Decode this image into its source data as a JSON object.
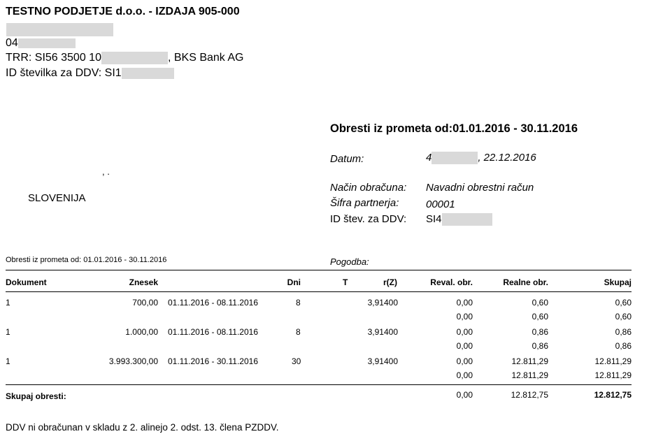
{
  "company": {
    "name": "TESTNO PODJETJE d.o.o. - IZDAJA 905-000",
    "line2_prefix": "04",
    "trr_prefix": "TRR: SI56 3500 10",
    "trr_suffix": ", BKS Bank AG",
    "ddv_prefix": "ID številka za DDV: SI1"
  },
  "recipient": {
    "address_fragment": ", .",
    "country": "SLOVENIJA"
  },
  "header": {
    "title": "Obresti iz prometa od:01.01.2016 - 30.11.2016",
    "datum_label": "Datum:",
    "datum_prefix": "4",
    "datum_value": ", 22.12.2016",
    "nacin_label": "Način obračuna:",
    "nacin_value": "Navadni obrestni račun",
    "sifra_label": "Šifra partnerja:",
    "sifra_value": "00001",
    "idddv_label": "ID štev. za DDV:",
    "idddv_prefix": "SI4"
  },
  "table": {
    "caption": "Obresti iz prometa od: 01.01.2016 - 30.11.2016",
    "pogodba_label": "Pogodba:",
    "columns": {
      "dokument": "Dokument",
      "znesek": "Znesek",
      "dni": "Dni",
      "t": "T",
      "rz": "r(Z)",
      "reval": "Reval. obr.",
      "realne": "Realne obr.",
      "skupaj": "Skupaj"
    },
    "rows": [
      {
        "dokument": "1",
        "znesek": "700,00",
        "obdobje": "01.11.2016 - 08.11.2016",
        "dni": "8",
        "rz": "3,91400",
        "reval": "0,00",
        "realne": "0,60",
        "skupaj": "0,60",
        "sub_reval": "0,00",
        "sub_realne": "0,60",
        "sub_skupaj": "0,60"
      },
      {
        "dokument": "1",
        "znesek": "1.000,00",
        "obdobje": "01.11.2016 - 08.11.2016",
        "dni": "8",
        "rz": "3,91400",
        "reval": "0,00",
        "realne": "0,86",
        "skupaj": "0,86",
        "sub_reval": "0,00",
        "sub_realne": "0,86",
        "sub_skupaj": "0,86"
      },
      {
        "dokument": "1",
        "znesek": "3.993.300,00",
        "obdobje": "01.11.2016 - 30.11.2016",
        "dni": "30",
        "rz": "3,91400",
        "reval": "0,00",
        "realne": "12.811,29",
        "skupaj": "12.811,29",
        "sub_reval": "0,00",
        "sub_realne": "12.811,29",
        "sub_skupaj": "12.811,29"
      }
    ],
    "total": {
      "label": "Skupaj obresti:",
      "reval": "0,00",
      "realne": "12.812,75",
      "skupaj": "12.812,75"
    }
  },
  "footer": {
    "note": "DDV ni obračunan v skladu z 2. alinejo 2. odst. 13. člena PZDDV."
  }
}
